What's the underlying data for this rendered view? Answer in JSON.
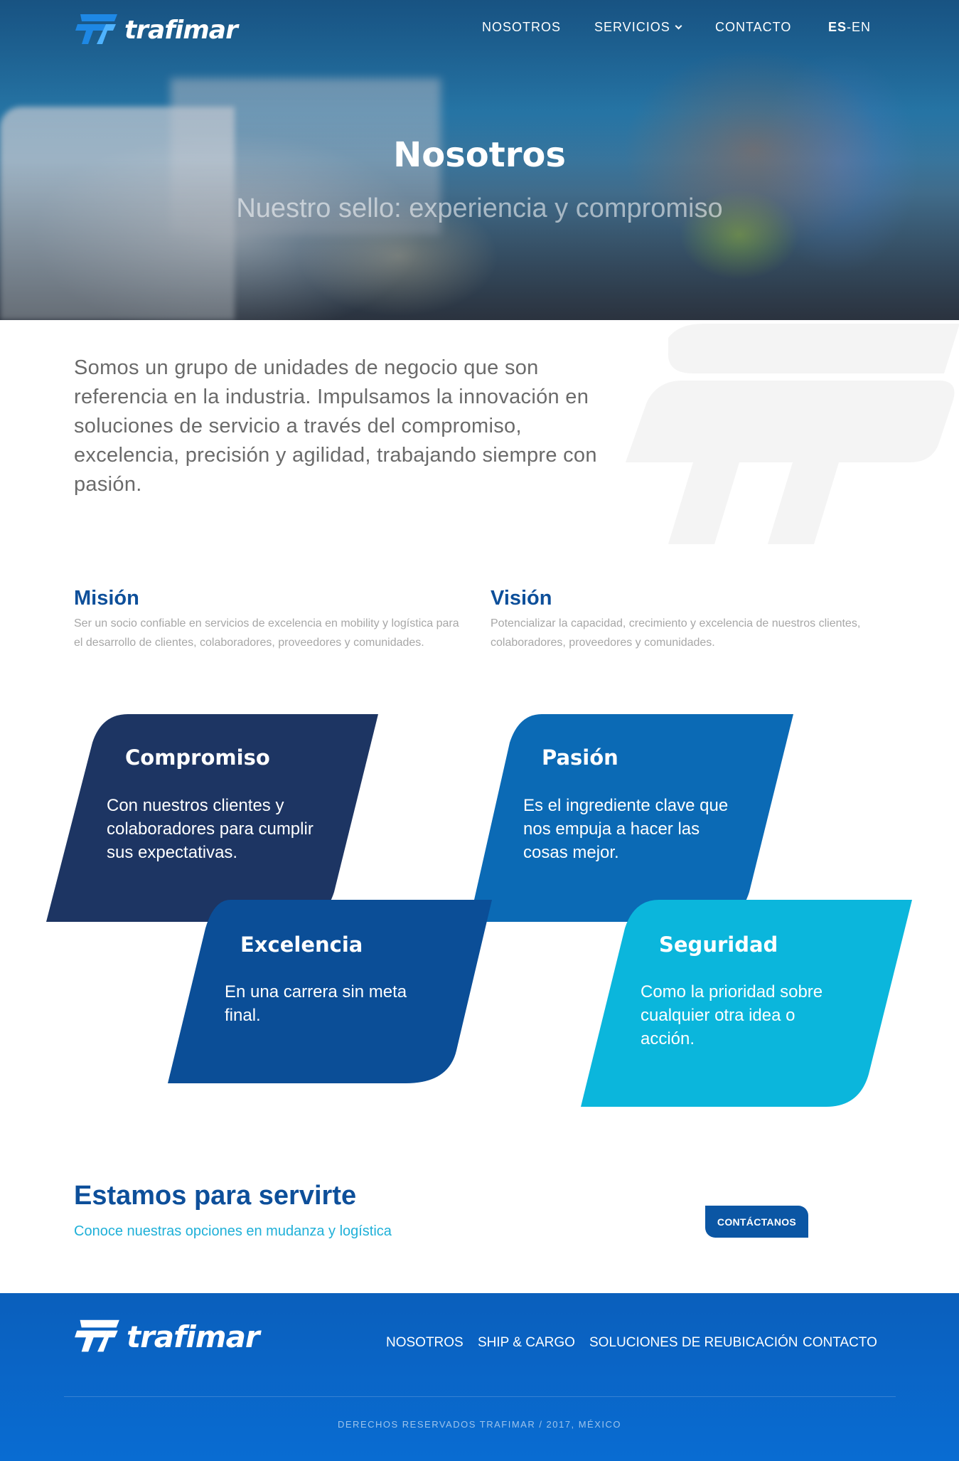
{
  "header": {
    "brand": "trafimar",
    "nav": [
      {
        "label": "NOSOTROS"
      },
      {
        "label": "SERVICIOS"
      },
      {
        "label": "CONTACTO"
      }
    ],
    "lang_es": "ES",
    "lang_sep": "-",
    "lang_en": "EN"
  },
  "hero": {
    "title": "Nosotros",
    "subtitle": "Nuestro sello: experiencia y compromiso"
  },
  "intro": {
    "text": "Somos un grupo de unidades de negocio que son referencia en la industria. Impulsamos la innovación en soluciones de servicio a través del compromiso, excelencia, precisión y agilidad, trabajando siempre con pasión."
  },
  "mission": {
    "title": "Misión",
    "text": "Ser un socio confiable en servicios de excelencia en mobility y logística para el desarrollo de clientes, colaboradores, proveedores y comunidades."
  },
  "vision": {
    "title": "Visión",
    "text": "Potencializar la capacidad, crecimiento y excelencia de nuestros clientes, colaboradores, proveedores y comunidades."
  },
  "values": [
    {
      "title": "Compromiso",
      "text": "Con nuestros clientes y colaboradores para cumplir sus expectativas.",
      "color": "#1d3563"
    },
    {
      "title": "Pasión",
      "text": "Es el ingrediente clave que nos empuja a hacer las cosas mejor.",
      "color": "#0b6ab5"
    },
    {
      "title": "Excelencia",
      "text": "En una carrera sin meta final.",
      "color": "#0b4e97"
    },
    {
      "title": "Seguridad",
      "text": "Como la prioridad sobre cualquier otra idea o acción.",
      "color": "#0bb6dc"
    }
  ],
  "cta": {
    "title": "Estamos para servirte",
    "subtitle": "Conoce nuestras opciones en mudanza y logística",
    "button": "CONTÁCTANOS"
  },
  "footer": {
    "brand": "trafimar",
    "nav": [
      {
        "label": "NOSOTROS"
      },
      {
        "label": "SHIP & CARGO"
      },
      {
        "label": "SOLUCIONES DE REUBICACIÓN"
      },
      {
        "label": "CONTACTO"
      }
    ],
    "copyright": "DERECHOS RESERVADOS TRAFIMAR / 2017, MÉXICO"
  }
}
